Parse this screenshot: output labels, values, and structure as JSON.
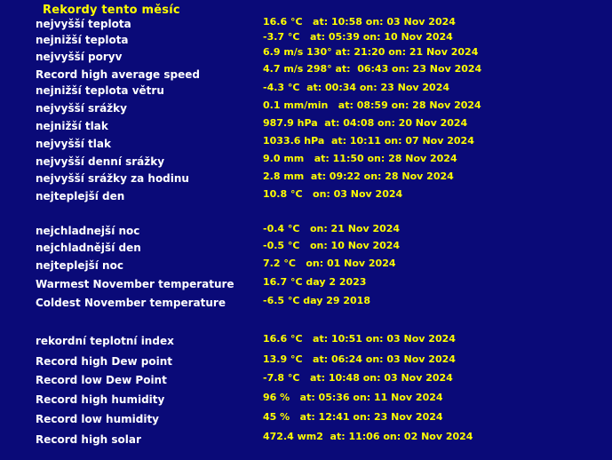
{
  "title": "Rekordy tento měsíc",
  "colors": {
    "background": "#0a0a78",
    "label": "#ffffff",
    "value": "#ffff00"
  },
  "records": [
    {
      "label": "nejvyšší teplota",
      "value": "16.6 °C   at: 10:58 on: 03 Nov 2024"
    },
    {
      "label": "nejnižší teplota",
      "value": "-3.7 °C   at: 05:39 on: 10 Nov 2024"
    },
    {
      "label": "nejvyšší poryv",
      "value": "6.9 m/s 130° at: 21:20 on: 21 Nov 2024"
    },
    {
      "label": "Record high average speed",
      "value": "4.7 m/s 298° at:  06:43 on: 23 Nov 2024"
    },
    {
      "label": "nejnižší teplota větru",
      "value": "-4.3 °C  at: 00:34 on: 23 Nov 2024"
    },
    {
      "label": "nejvyšší srážky",
      "value": "0.1 mm/min   at: 08:59 on: 28 Nov 2024"
    },
    {
      "label": "nejnižší tlak",
      "value": "987.9 hPa  at: 04:08 on: 20 Nov 2024"
    },
    {
      "label": "nejvyšší tlak",
      "value": "1033.6 hPa  at: 10:11 on: 07 Nov 2024"
    },
    {
      "label": "nejvyšší denní srážky",
      "value": "9.0 mm   at: 11:50 on: 28 Nov 2024"
    },
    {
      "label": "nejvyšší srážky za hodinu",
      "value": "2.8 mm  at: 09:22 on: 28 Nov 2024"
    },
    {
      "label": "nejteplejší den",
      "value": "10.8 °C   on: 03 Nov 2024"
    },
    {
      "label": "nejchladnejší noc",
      "value": "-0.4 °C   on: 21 Nov 2024"
    },
    {
      "label": "nejchladnější den",
      "value": "-0.5 °C   on: 10 Nov 2024"
    },
    {
      "label": "nejteplejší noc",
      "value": "7.2 °C   on: 01 Nov 2024"
    },
    {
      "label": "Warmest November temperature",
      "value": "16.7 °C day 2 2023"
    },
    {
      "label": "Coldest November temperature",
      "value": "-6.5 °C day 29 2018"
    },
    {
      "label": "rekordní teplotní index",
      "value": "16.6 °C   at: 10:51 on: 03 Nov 2024"
    },
    {
      "label": "Record high Dew point",
      "value": "13.9 °C   at: 06:24 on: 03 Nov 2024"
    },
    {
      "label": "Record low Dew Point",
      "value": "-7.8 °C   at: 10:48 on: 03 Nov 2024"
    },
    {
      "label": "Record high humidity",
      "value": "96 %   at: 05:36 on: 11 Nov 2024"
    },
    {
      "label": "Record low humidity",
      "value": "45 %   at: 12:41 on: 23 Nov 2024"
    },
    {
      "label": "Record high solar",
      "value": "472.4 wm2  at: 11:06 on: 02 Nov 2024"
    }
  ]
}
